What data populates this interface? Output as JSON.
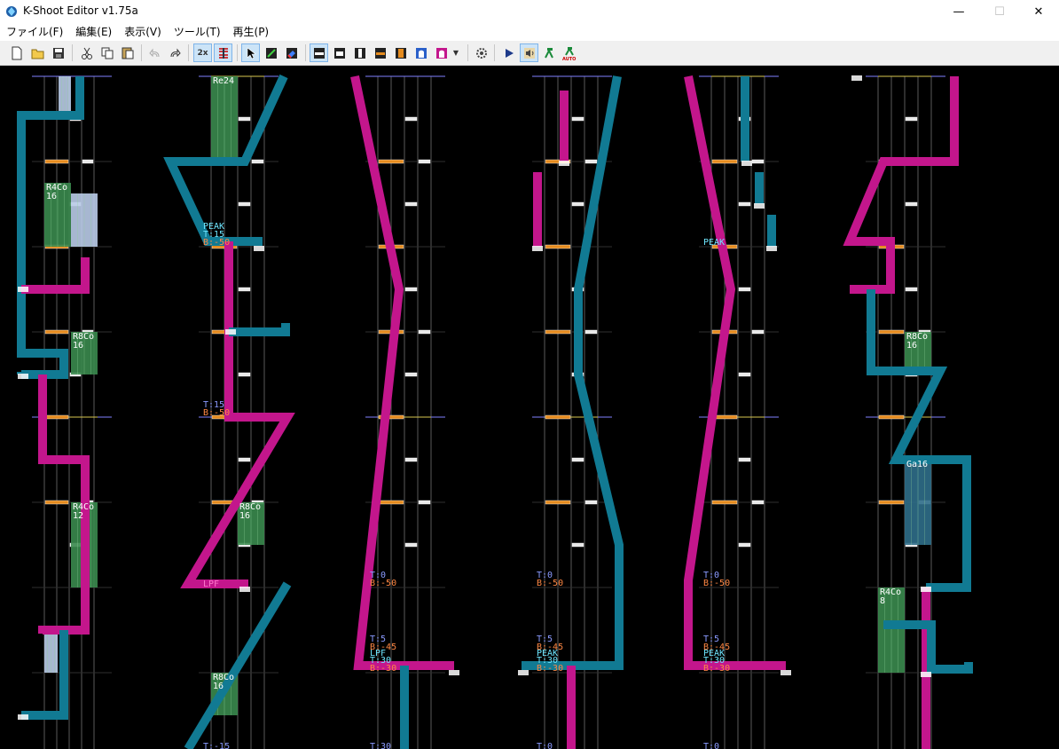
{
  "window": {
    "title": "K-Shoot Editor v1.75a",
    "controls": {
      "minimize": "—",
      "maximize": "☐",
      "close": "✕"
    }
  },
  "menu": {
    "items": [
      "ファイル(F)",
      "編集(E)",
      "表示(V)",
      "ツール(T)",
      "再生(P)"
    ]
  },
  "toolbar": {
    "zoom_label": "2x",
    "auto_label": "AUTO"
  },
  "colors": {
    "lane_line": "#5a5a5a",
    "measure_line": "#8080ff",
    "beat_line": "#c0c0c0",
    "laser_left": "#117a93",
    "laser_right": "#c3168c",
    "fx_long": "#3a8a4e",
    "bt_long": "#b9cbe8",
    "chip_white": "#e8e8e8",
    "chip_orange": "#e58b1e",
    "text_cyan": "#6ee6ff",
    "text_orange": "#ff8844",
    "text_blue": "#8b9bff"
  },
  "editor": {
    "labels": [
      {
        "id": "r4co-16",
        "text": "R4Co\n16",
        "color": "#ffffff"
      },
      {
        "id": "r8co-16-a",
        "text": "R8Co\n16",
        "color": "#ffffff"
      },
      {
        "id": "r4co-12",
        "text": "R4Co\n12",
        "color": "#ffffff"
      },
      {
        "id": "re24",
        "text": "Re24",
        "color": "#ffffff"
      },
      {
        "id": "peak-t15",
        "text": "PEAK",
        "color": "#6ee6ff"
      },
      {
        "id": "t15-a",
        "text": "T:15",
        "color": "#6ee6ff"
      },
      {
        "id": "b-50-a",
        "text": "B:-50",
        "color": "#ff8844"
      },
      {
        "id": "t15-b",
        "text": "T:15",
        "color": "#8b9bff"
      },
      {
        "id": "b-50-b",
        "text": "B:-50",
        "color": "#ff8844"
      },
      {
        "id": "r8co-16-b",
        "text": "R8Co\n16",
        "color": "#ffffff"
      },
      {
        "id": "lpf-1",
        "text": "LPF",
        "color": "#ff77cc"
      },
      {
        "id": "r8co-16-c",
        "text": "R8Co\n16",
        "color": "#ffffff"
      },
      {
        "id": "t-15",
        "text": "T:-15",
        "color": "#8b9bff"
      },
      {
        "id": "t0-a",
        "text": "T:0",
        "color": "#8b9bff"
      },
      {
        "id": "b-50-c",
        "text": "B:-50",
        "color": "#ff8844"
      },
      {
        "id": "t5-a",
        "text": "T:5",
        "color": "#8b9bff"
      },
      {
        "id": "b-45-a",
        "text": "B:-45",
        "color": "#ff8844"
      },
      {
        "id": "lpf-2",
        "text": "LPF",
        "color": "#6ee6ff"
      },
      {
        "id": "t30-a",
        "text": "T:30",
        "color": "#6ee6ff"
      },
      {
        "id": "b-30-a",
        "text": "B:-30",
        "color": "#ff8844"
      },
      {
        "id": "t30-b",
        "text": "T:30",
        "color": "#8b9bff"
      },
      {
        "id": "t0-b",
        "text": "T:0",
        "color": "#8b9bff"
      },
      {
        "id": "b-50-d",
        "text": "B:-50",
        "color": "#ff8844"
      },
      {
        "id": "t5-b",
        "text": "T:5",
        "color": "#8b9bff"
      },
      {
        "id": "b-45-b",
        "text": "B:-45",
        "color": "#ff8844"
      },
      {
        "id": "peak-2",
        "text": "PEAK",
        "color": "#6ee6ff"
      },
      {
        "id": "t30-c",
        "text": "T:30",
        "color": "#6ee6ff"
      },
      {
        "id": "b-30-b",
        "text": "B:-30",
        "color": "#ff8844"
      },
      {
        "id": "t0-c",
        "text": "T:0",
        "color": "#8b9bff"
      },
      {
        "id": "peak-3",
        "text": "PEAK",
        "color": "#6ee6ff"
      },
      {
        "id": "t0-d",
        "text": "T:0",
        "color": "#8b9bff"
      },
      {
        "id": "b-50-e",
        "text": "B:-50",
        "color": "#ff8844"
      },
      {
        "id": "t5-c",
        "text": "T:5",
        "color": "#8b9bff"
      },
      {
        "id": "b-45-c",
        "text": "B:-45",
        "color": "#ff8844"
      },
      {
        "id": "peak-4",
        "text": "PEAK",
        "color": "#6ee6ff"
      },
      {
        "id": "t30-d",
        "text": "T:30",
        "color": "#6ee6ff"
      },
      {
        "id": "b-30-c",
        "text": "B:-30",
        "color": "#ff8844"
      },
      {
        "id": "t0-e",
        "text": "T:0",
        "color": "#8b9bff"
      },
      {
        "id": "r8co-16-d",
        "text": "R8Co\n16",
        "color": "#ffffff"
      },
      {
        "id": "ga16",
        "text": "Ga16",
        "color": "#ffffff"
      },
      {
        "id": "r4co-8",
        "text": "R4Co\n8",
        "color": "#ffffff"
      }
    ]
  }
}
